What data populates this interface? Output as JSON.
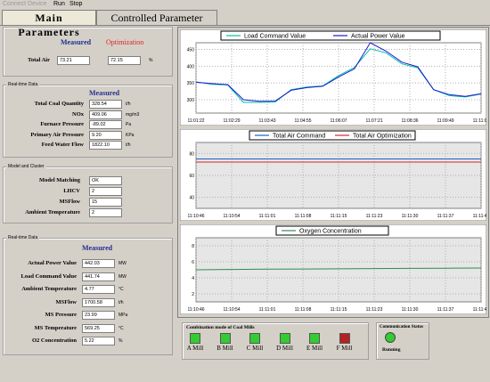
{
  "menu": {
    "connect": "Connect Device",
    "run": "Run",
    "stop": "Stop"
  },
  "tabs": [
    {
      "label": "Main Parameters"
    },
    {
      "label": "Controlled Parameter"
    }
  ],
  "total_air": {
    "measured_header": "Measured",
    "optimization_header": "Optimization",
    "label": "Total Air",
    "measured_value": "73.21",
    "optimization_value": "72.15",
    "unit": "%"
  },
  "realtime1": {
    "title": "Real-time Data",
    "header": "Measured",
    "rows": [
      {
        "label": "Total Coal Quantity",
        "value": "328.54",
        "unit": "t/h"
      },
      {
        "label": "NOx",
        "value": "409.06",
        "unit": "mg/m3"
      },
      {
        "label": "Furnace Pressure",
        "value": "-89.02",
        "unit": "Pa"
      },
      {
        "label": "Primary Air Pressure",
        "value": "9.20",
        "unit": "KPa"
      },
      {
        "label": "Feed Water Flow",
        "value": "1822.10",
        "unit": "t/h"
      }
    ]
  },
  "model": {
    "title": "Model and Cluster",
    "rows": [
      {
        "label": "Model Matching",
        "value": "OK"
      },
      {
        "label": "LHCV",
        "value": "2"
      },
      {
        "label": "MSFlow",
        "value": "15"
      },
      {
        "label": "Ambient Temperature",
        "value": "2"
      }
    ]
  },
  "realtime2": {
    "title": "Real-time Data",
    "header": "Measured",
    "rows": [
      {
        "label": "Actual Power Value",
        "value": "442.03",
        "unit": "MW"
      },
      {
        "label": "Load Command Value",
        "value": "441.74",
        "unit": "MW"
      },
      {
        "label": "Ambient Temperature",
        "value": "4.77",
        "unit": "°C"
      },
      {
        "label": "MSFlow",
        "value": "1700.58",
        "unit": "t/h"
      },
      {
        "label": "MS Pressure",
        "value": "23.99",
        "unit": "MPa"
      },
      {
        "label": "MS Temperature",
        "value": "569.25",
        "unit": "°C"
      },
      {
        "label": "O2 Concentration",
        "value": "5.22",
        "unit": "%"
      }
    ]
  },
  "mills": {
    "title": "Combination mode of Coal Mills",
    "items": [
      {
        "label": "A Mill",
        "color": "#33cc33"
      },
      {
        "label": "B Mill",
        "color": "#33cc33"
      },
      {
        "label": "C Mill",
        "color": "#33cc33"
      },
      {
        "label": "D Mill",
        "color": "#33cc33"
      },
      {
        "label": "E Mill",
        "color": "#33cc33"
      },
      {
        "label": "F Mill",
        "color": "#b22222"
      }
    ]
  },
  "comm": {
    "title": "Communication Status",
    "status": "Running",
    "color": "#33cc33"
  },
  "chart_data": [
    {
      "type": "line",
      "x": [
        "11:01:22",
        "11:02:29",
        "11:03:43",
        "11:04:55",
        "11:06:07",
        "11:07:21",
        "11:08:36",
        "11:09:49",
        "11:11:01"
      ],
      "ylim": [
        260,
        470
      ],
      "yticks": [
        450,
        400,
        350,
        300
      ],
      "grid": true,
      "series": [
        {
          "name": "Load Command Value",
          "color": "#00bfa5",
          "values": [
            353,
            346,
            344,
            292,
            292,
            293,
            330,
            338,
            341,
            372,
            396,
            452,
            440,
            407,
            395,
            330,
            312,
            308,
            317
          ]
        },
        {
          "name": "Actual Power Value",
          "color": "#1a1ad0",
          "values": [
            352,
            348,
            345,
            300,
            295,
            296,
            328,
            336,
            340,
            368,
            392,
            470,
            445,
            412,
            398,
            330,
            315,
            310,
            318
          ]
        }
      ]
    },
    {
      "type": "line",
      "x": [
        "11:10:46",
        "11:10:54",
        "11:11:01",
        "11:11:08",
        "11:11:15",
        "11:11:23",
        "11:11:30",
        "11:11:37",
        "11:11:45"
      ],
      "ylim": [
        30,
        90
      ],
      "yticks": [
        80,
        60,
        40
      ],
      "grid": true,
      "series": [
        {
          "name": "Total Air Command",
          "color": "#1565c0",
          "values": [
            75,
            75,
            75,
            75,
            75,
            75,
            75,
            75,
            75
          ]
        },
        {
          "name": "Total Air Optimization",
          "color": "#d62728",
          "values": [
            72.2,
            72.2,
            72.2,
            72.2,
            72.2,
            72.2,
            72.2,
            72.2,
            72.2
          ]
        }
      ]
    },
    {
      "type": "line",
      "x": [
        "11:10:46",
        "11:10:54",
        "11:11:01",
        "11:11:08",
        "11:11:15",
        "11:11:23",
        "11:11:30",
        "11:11:37",
        "11:11:45"
      ],
      "ylim": [
        1,
        9
      ],
      "yticks": [
        8,
        6,
        4,
        2
      ],
      "grid": true,
      "series": [
        {
          "name": "Oxygen Concentration",
          "color": "#2e8b57",
          "values": [
            5.0,
            5.05,
            5.08,
            5.1,
            5.12,
            5.15,
            5.18,
            5.2,
            5.22
          ]
        }
      ]
    }
  ]
}
